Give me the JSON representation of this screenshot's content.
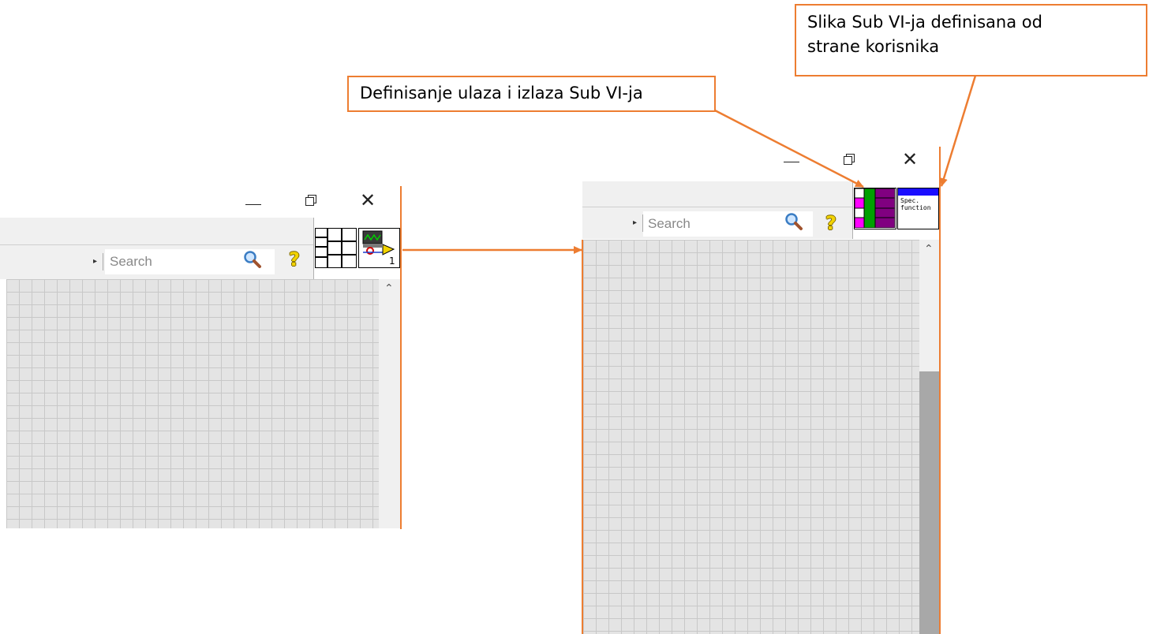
{
  "callouts": {
    "connector_pane": "Definisanje ulaza i izlaza Sub VI-ja",
    "vi_icon_line1": "Slika Sub VI-ja definisana od",
    "vi_icon_line2": "strane korisnika"
  },
  "left_window": {
    "search_placeholder": "Search",
    "vi_icon_number": "1",
    "controls": {
      "minimize": "minimize-icon",
      "restore": "restore-icon",
      "close": "close-icon"
    }
  },
  "right_window": {
    "search_placeholder": "Search",
    "vi_icon_text_line1": "Spec.",
    "vi_icon_text_line2": "function",
    "controls": {
      "minimize": "minimize-icon",
      "restore": "restore-icon",
      "close": "close-icon"
    }
  },
  "colors": {
    "callout_border": "#ed7d31",
    "grid_bg": "#e4e4e4",
    "terminal_magenta": "#ff00ff",
    "terminal_green": "#00a000",
    "terminal_purple": "#800080",
    "spec_bar_blue": "#1a0dff"
  },
  "icons": [
    "search-icon",
    "help-icon",
    "connector-pane-icon",
    "vi-icon",
    "scroll-up-icon"
  ]
}
